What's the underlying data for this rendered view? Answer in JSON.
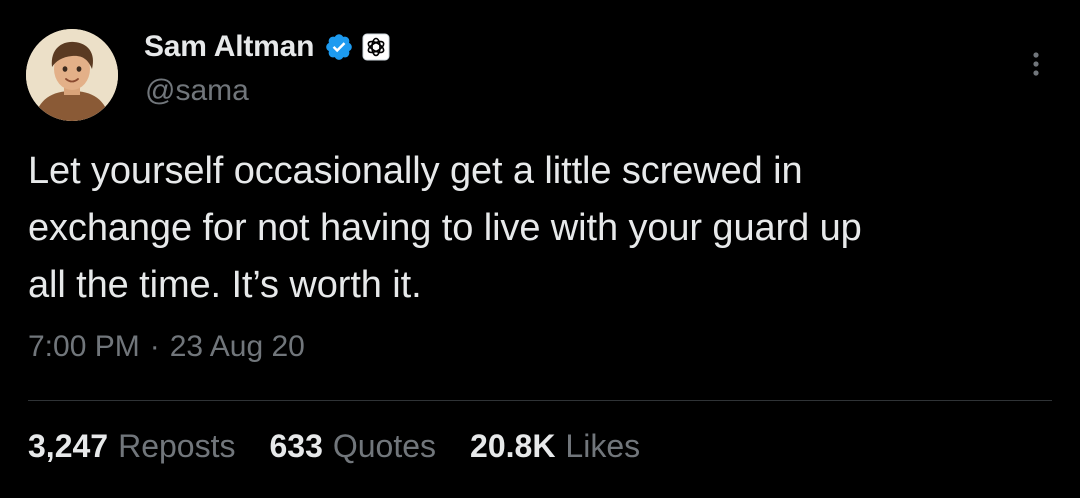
{
  "author": {
    "display_name": "Sam Altman",
    "handle": "@sama",
    "verified": true,
    "verified_color": "#1d9bf0",
    "affiliate_badge": "openai-logo-icon"
  },
  "tweet": {
    "text": "Let yourself occasionally get a little screwed in\nexchange for not having to live with your guard up\nall the time. It’s worth it.",
    "time": "7:00 PM",
    "separator": "·",
    "date": "23 Aug 20"
  },
  "stats": [
    {
      "count": "3,247",
      "label": "Reposts"
    },
    {
      "count": "633",
      "label": "Quotes"
    },
    {
      "count": "20.8K",
      "label": "Likes"
    }
  ],
  "colors": {
    "background": "#000000",
    "primary_text": "#e7e9ea",
    "secondary_text": "#71767b",
    "divider": "#2f3336"
  },
  "icons": {
    "more": "more-vertical-icon",
    "verified": "verified-badge-icon"
  }
}
